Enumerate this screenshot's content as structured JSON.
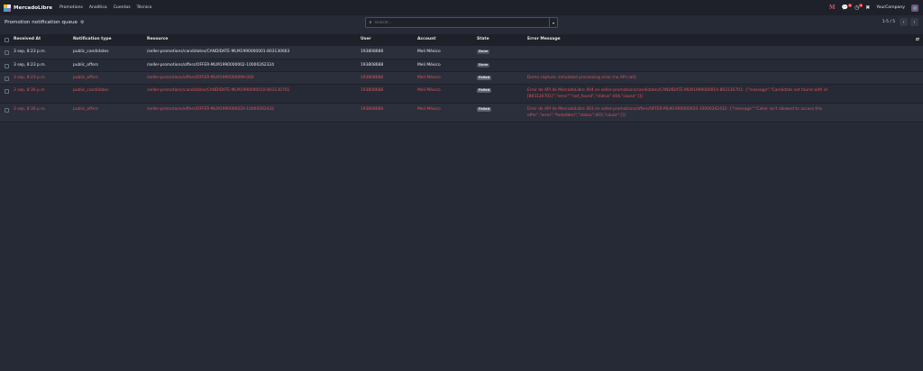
{
  "navbar": {
    "brand": "MercadoLibre",
    "menu": [
      "Promotions",
      "Analítica",
      "Cuentas",
      "Técnico"
    ],
    "company": "YourCompany",
    "icons": {
      "gmail": "M",
      "chat_badge": "6",
      "activity_badge": "4"
    }
  },
  "control": {
    "title": "Promotion notification queue",
    "search_placeholder": "Buscar...",
    "pager": "1-5 / 5"
  },
  "table": {
    "columns": [
      "Received At",
      "Notification type",
      "Resource",
      "User",
      "Account",
      "State",
      "Error Message"
    ],
    "rows": [
      {
        "received": "3 sep, 8:23 p.m.",
        "type": "public_candidates",
        "resource": "/seller-promotions/candidates/CANDIDATE-MLM1990000001-803130663",
        "user": "193808688",
        "account": "Meli México",
        "state": "Done",
        "error": ""
      },
      {
        "received": "3 sep, 8:23 p.m.",
        "type": "public_offers",
        "resource": "/seller-promotions/offers/OFFER-MLM1990000002-10000262324",
        "user": "193808688",
        "account": "Meli México",
        "state": "Done",
        "error": ""
      },
      {
        "received": "3 sep, 8:23 p.m.",
        "type": "public_offers",
        "resource": "/seller-promotions/offers/OFFER-MLM1990000099-000",
        "user": "193808688",
        "account": "Meli México",
        "state": "Failed",
        "error": "Demo capture: simulated processing error (no API call)."
      },
      {
        "received": "3 sep, 8:36 p.m.",
        "type": "public_candidates",
        "resource": "/seller-promotions/candidates/CANDIDATE-MLM1990000010-803130701",
        "user": "193808688",
        "account": "Meli México",
        "state": "Failed",
        "error": "Error de API de MercadoLibre 404 en seller-promotions/candidates/CANDIDATE-MLM1990000010-803130701: {\"message\":\"Candidate not found with id [803130701]\",\"error\":\"not_found\",\"status\":404,\"cause\":[]}"
      },
      {
        "received": "3 sep, 8:36 p.m.",
        "type": "public_offers",
        "resource": "/seller-promotions/offers/OFFER-MLM1990000020-10000262432",
        "user": "193808688",
        "account": "Meli México",
        "state": "Failed",
        "error": "Error de API de MercadoLibre 403 en seller-promotions/offers/OFFER-MLM1990000020-10000262432: {\"message\":\"Caller isn't allowed to access this offer\",\"error\":\"forbidden\",\"status\":403,\"cause\":[]}"
      }
    ]
  },
  "colors": {
    "background": "#262A36",
    "navbar": "#1E2129",
    "failed_text": "#E05458"
  }
}
